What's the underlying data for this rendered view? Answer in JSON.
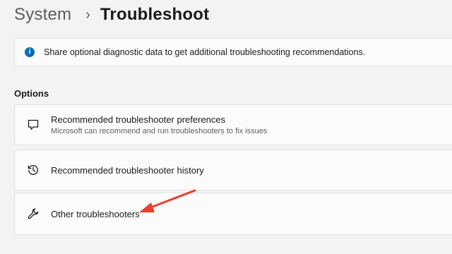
{
  "breadcrumb": {
    "parent": "System",
    "separator": "›",
    "current": "Troubleshoot"
  },
  "info_banner": {
    "icon": "info-icon",
    "text": "Share optional diagnostic data to get additional troubleshooting recommendations."
  },
  "options_section": {
    "heading": "Options",
    "items": [
      {
        "icon": "chat-bubble-icon",
        "title": "Recommended troubleshooter preferences",
        "subtitle": "Microsoft can recommend and run troubleshooters to fix issues"
      },
      {
        "icon": "history-icon",
        "title": "Recommended troubleshooter history"
      },
      {
        "icon": "wrench-icon",
        "title": "Other troubleshooters"
      }
    ]
  },
  "annotation": {
    "type": "arrow",
    "color": "#e5412d",
    "points_to": "Other troubleshooters"
  },
  "colors": {
    "background": "#f3f3f3",
    "card": "#fbfbfb",
    "accent": "#0f6cbd"
  }
}
